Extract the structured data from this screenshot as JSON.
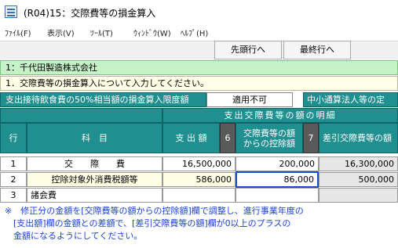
{
  "window": {
    "title": "(R04)15：交際費等の損金算入"
  },
  "menu": [
    {
      "label": "ﾌｧｲﾙ(F)"
    },
    {
      "label": "表示(V)"
    },
    {
      "label": "ﾂｰﾙ(T)"
    },
    {
      "label": "ｳｨﾝﾄﾞｳ(W)"
    },
    {
      "label": "ﾍﾙﾌﾟ(H)"
    }
  ],
  "toolbar": {
    "first_row": "先頭行へ",
    "last_row": "最終行へ"
  },
  "company": "1：千代田製造株式会社",
  "section_title": "1．交際費等の損金算入について入力してください。",
  "limit": {
    "label": "支出接待飲食費の50%相当額の損金算入限度額",
    "value": "適用不可",
    "sme_label": "中小通算法人等の定"
  },
  "table": {
    "detail_header": "支出交際費等の額の明細",
    "headers": {
      "row": "行",
      "subject": "科　目",
      "spent": "支 出 額",
      "spent_no": "6",
      "deduct_line1": "交際費等の額",
      "deduct_line2": "からの控除額",
      "deduct_no": "7",
      "net": "差引交際費等の額"
    },
    "rows": [
      {
        "no": "1",
        "subject": "交　　際　　費",
        "spent": "16,500,000",
        "deduct": "200,000",
        "net": "16,300,000"
      },
      {
        "no": "2",
        "subject": "控除対象外消費税額等",
        "spent": "586,000",
        "deduct": "86,000",
        "net": "500,000"
      },
      {
        "no": "3",
        "subject": "諸会費",
        "spent": "",
        "deduct": "",
        "net": ""
      }
    ]
  },
  "notes": [
    "※　修正分の金額を[交際費等の額からの控除額]欄で調整し、進行事業年度の",
    "　[支出額]欄の金額との差額で、[差引交際費等の額]欄が0以上のプラスの",
    "　金額になるようにしてください。"
  ],
  "colors": {
    "teal": "#1f8f8f",
    "company_green": "#c5f2c7",
    "note_blue": "#1a3fd6",
    "focus_blue": "#1a4fd0"
  }
}
